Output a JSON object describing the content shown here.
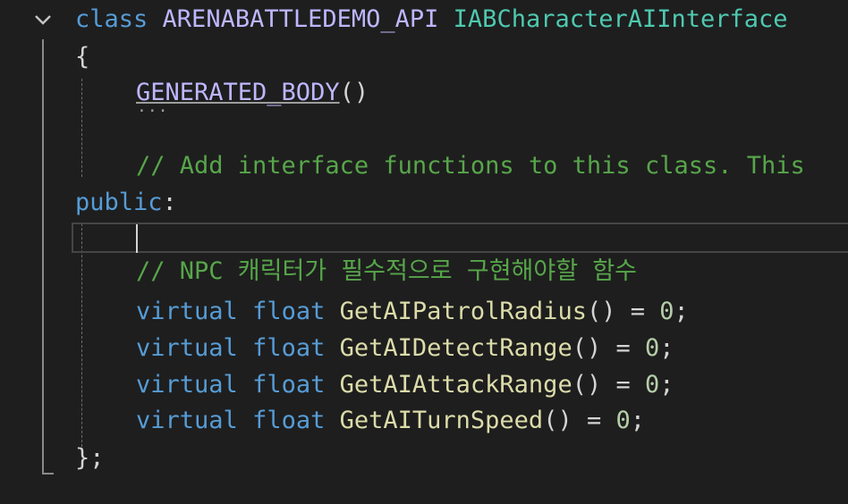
{
  "colors": {
    "background": "#1e1e1e",
    "keyword": "#569cd6",
    "macro": "#beb7ff",
    "type": "#4ec9b0",
    "function": "#dcdcaa",
    "number": "#b5cea8",
    "comment": "#57a64a",
    "text": "#d4d4d4"
  },
  "code": {
    "class_keyword": "class",
    "api_macro": "ARENABATTLEDEMO_API",
    "class_name": "IABCharacterAIInterface",
    "open_brace": "{",
    "generated_body": "GENERATED_BODY",
    "generated_parens": "()",
    "ellipsis": "...",
    "comment_add": "// Add interface functions to this class. This",
    "public_keyword": "public",
    "public_colon": ":",
    "comment_npc": "// NPC 캐릭터가 필수적으로 구현해야할 함수",
    "virtual_keyword": "virtual",
    "float_keyword": "float",
    "functions": [
      {
        "name": "GetAIPatrolRadius",
        "suffix": "() = ",
        "value": "0",
        "end": ";"
      },
      {
        "name": "GetAIDetectRange",
        "suffix": "() = ",
        "value": "0",
        "end": ";"
      },
      {
        "name": "GetAIAttackRange",
        "suffix": "() = ",
        "value": "0",
        "end": ";"
      },
      {
        "name": "GetAITurnSpeed",
        "suffix": "() = ",
        "value": "0",
        "end": ";"
      }
    ],
    "close_brace": "};"
  },
  "icons": {
    "fold": "chevron-down-icon"
  }
}
